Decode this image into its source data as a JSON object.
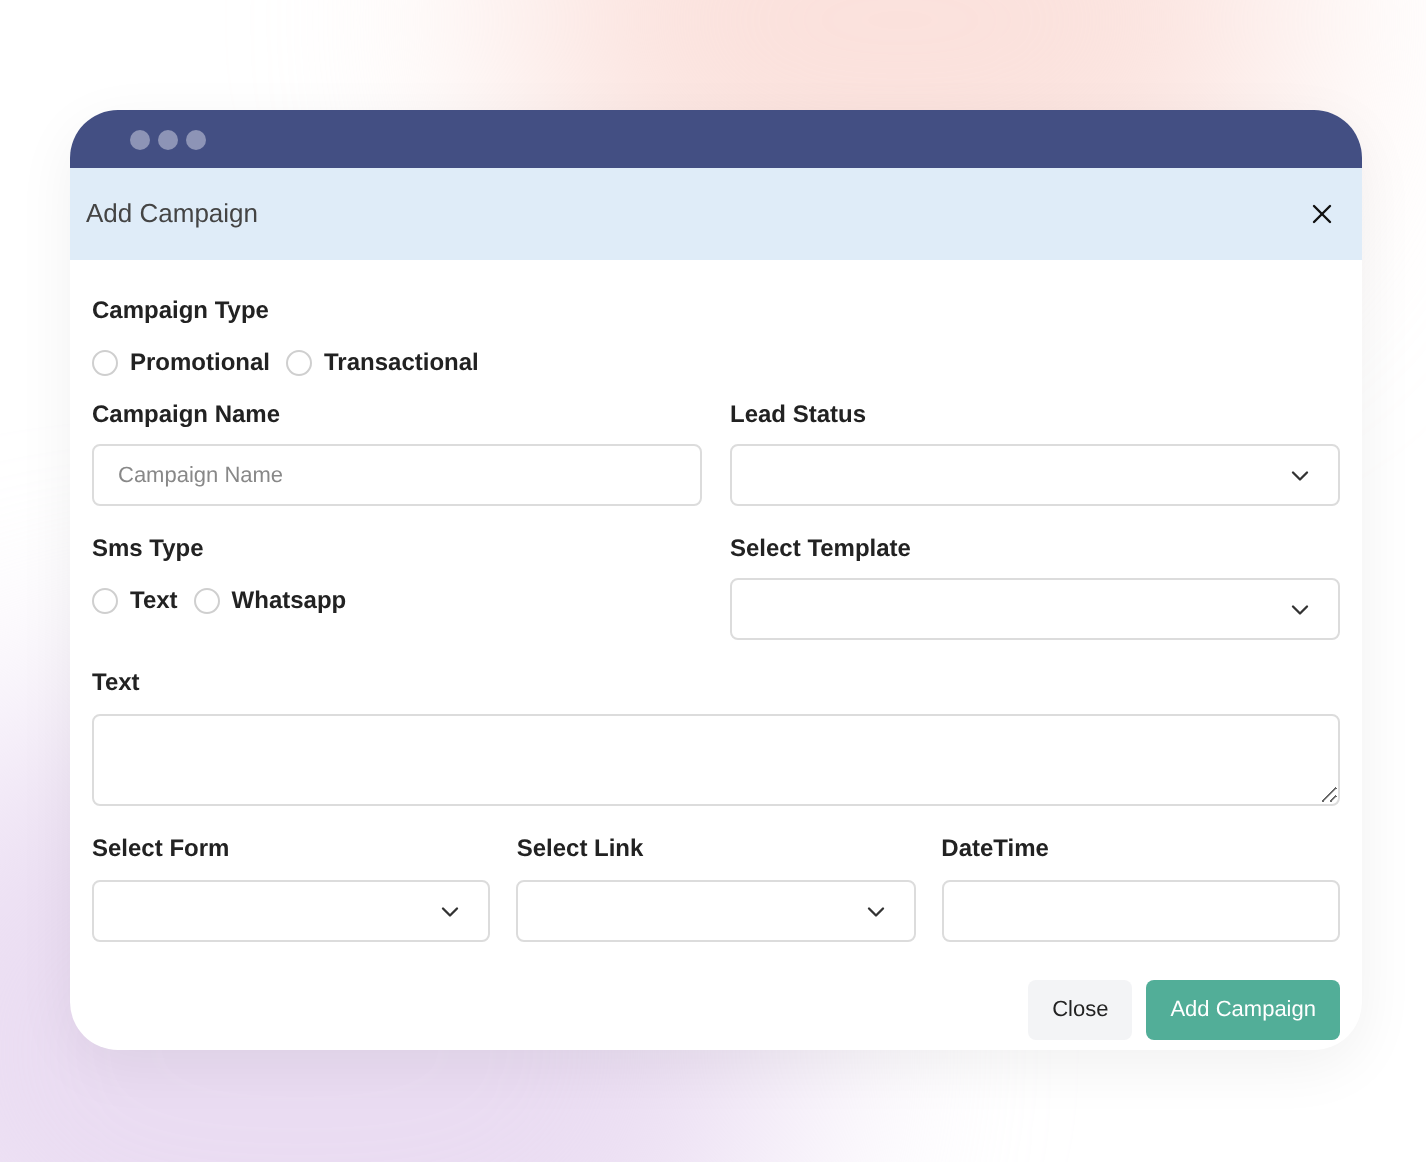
{
  "dialog": {
    "title": "Add Campaign"
  },
  "campaign_type": {
    "label": "Campaign Type",
    "options": [
      {
        "label": "Promotional",
        "selected": false
      },
      {
        "label": "Transactional",
        "selected": false
      }
    ]
  },
  "campaign_name": {
    "label": "Campaign Name",
    "placeholder": "Campaign Name"
  },
  "lead_status": {
    "label": "Lead Status"
  },
  "sms_type": {
    "label": "Sms Type",
    "options": [
      {
        "label": "Text",
        "selected": false
      },
      {
        "label": "Whatsapp",
        "selected": false
      }
    ]
  },
  "select_template": {
    "label": "Select Template"
  },
  "text": {
    "label": "Text"
  },
  "select_form": {
    "label": "Select Form"
  },
  "select_link": {
    "label": "Select Link"
  },
  "datetime": {
    "label": "DateTime"
  },
  "buttons": [
    {
      "label": "Close",
      "kind": "secondary"
    },
    {
      "label": "Add Campaign",
      "kind": "primary"
    }
  ]
}
